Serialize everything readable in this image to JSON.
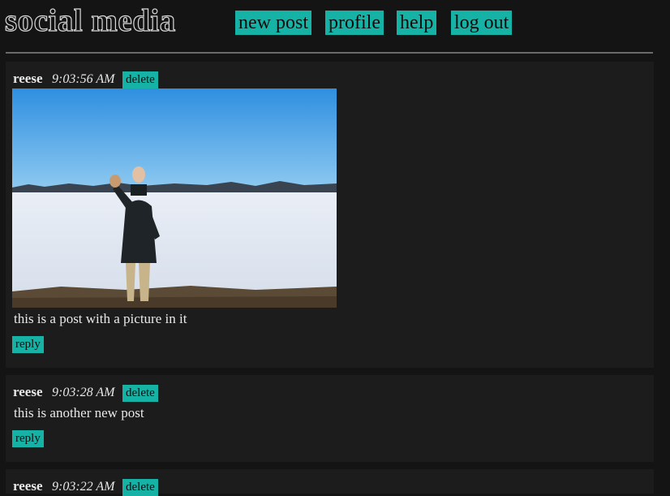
{
  "header": {
    "site_title": "social media",
    "nav": [
      {
        "label": "new post",
        "name": "nav-new-post-button"
      },
      {
        "label": "profile",
        "name": "nav-profile-button"
      },
      {
        "label": "help",
        "name": "nav-help-button"
      },
      {
        "label": "log out",
        "name": "nav-log-out-button"
      }
    ]
  },
  "posts": [
    {
      "author": "reese",
      "time": "9:03:56 AM",
      "delete_label": "delete",
      "has_image": true,
      "image_description_icon": "photo-icon",
      "body": "this is a post with a picture in it",
      "reply_label": "reply"
    },
    {
      "author": "reese",
      "time": "9:03:28 AM",
      "delete_label": "delete",
      "has_image": false,
      "body": "this is another new post",
      "reply_label": "reply"
    },
    {
      "author": "reese",
      "time": "9:03:22 AM",
      "delete_label": "delete",
      "has_image": false,
      "body": "",
      "reply_label": ""
    }
  ],
  "colors": {
    "background": "#141414",
    "post_background": "#1c1c1c",
    "accent": "#17b2a6",
    "text": "#e8e8e8",
    "divider": "#6a6a6a"
  }
}
